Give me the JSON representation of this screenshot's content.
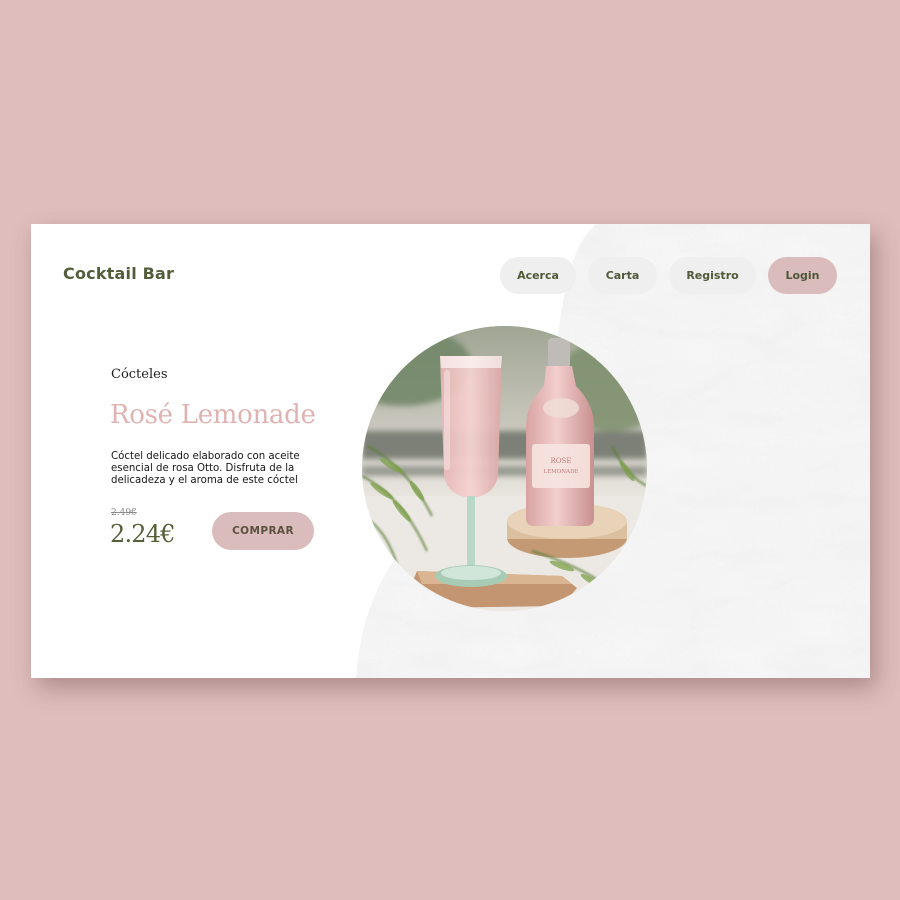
{
  "header": {
    "brand": "Cocktail Bar",
    "nav": [
      {
        "label": "Acerca"
      },
      {
        "label": "Carta"
      },
      {
        "label": "Registro"
      },
      {
        "label": "Login"
      }
    ]
  },
  "product": {
    "category": "Cócteles",
    "name": "Rosé Lemonade",
    "description": "Cóctel delicado elaborado con aceite esencial de rosa Otto. Disfruta de la delicadeza y el aroma de este cóctel",
    "old_price": "2.49€",
    "price": "2.24€",
    "buy_label": "COMPRAR",
    "bottle_label_line1": "ROSE",
    "bottle_label_line2": "LEMONADE"
  },
  "colors": {
    "page_background": "#dfbdbc",
    "accent_pink": "#dbbcbc",
    "title_pink": "#dfb3b2",
    "olive_text": "#545d3b",
    "nav_pill": "#efefef"
  },
  "icons": [
    "cocktail-photo"
  ]
}
